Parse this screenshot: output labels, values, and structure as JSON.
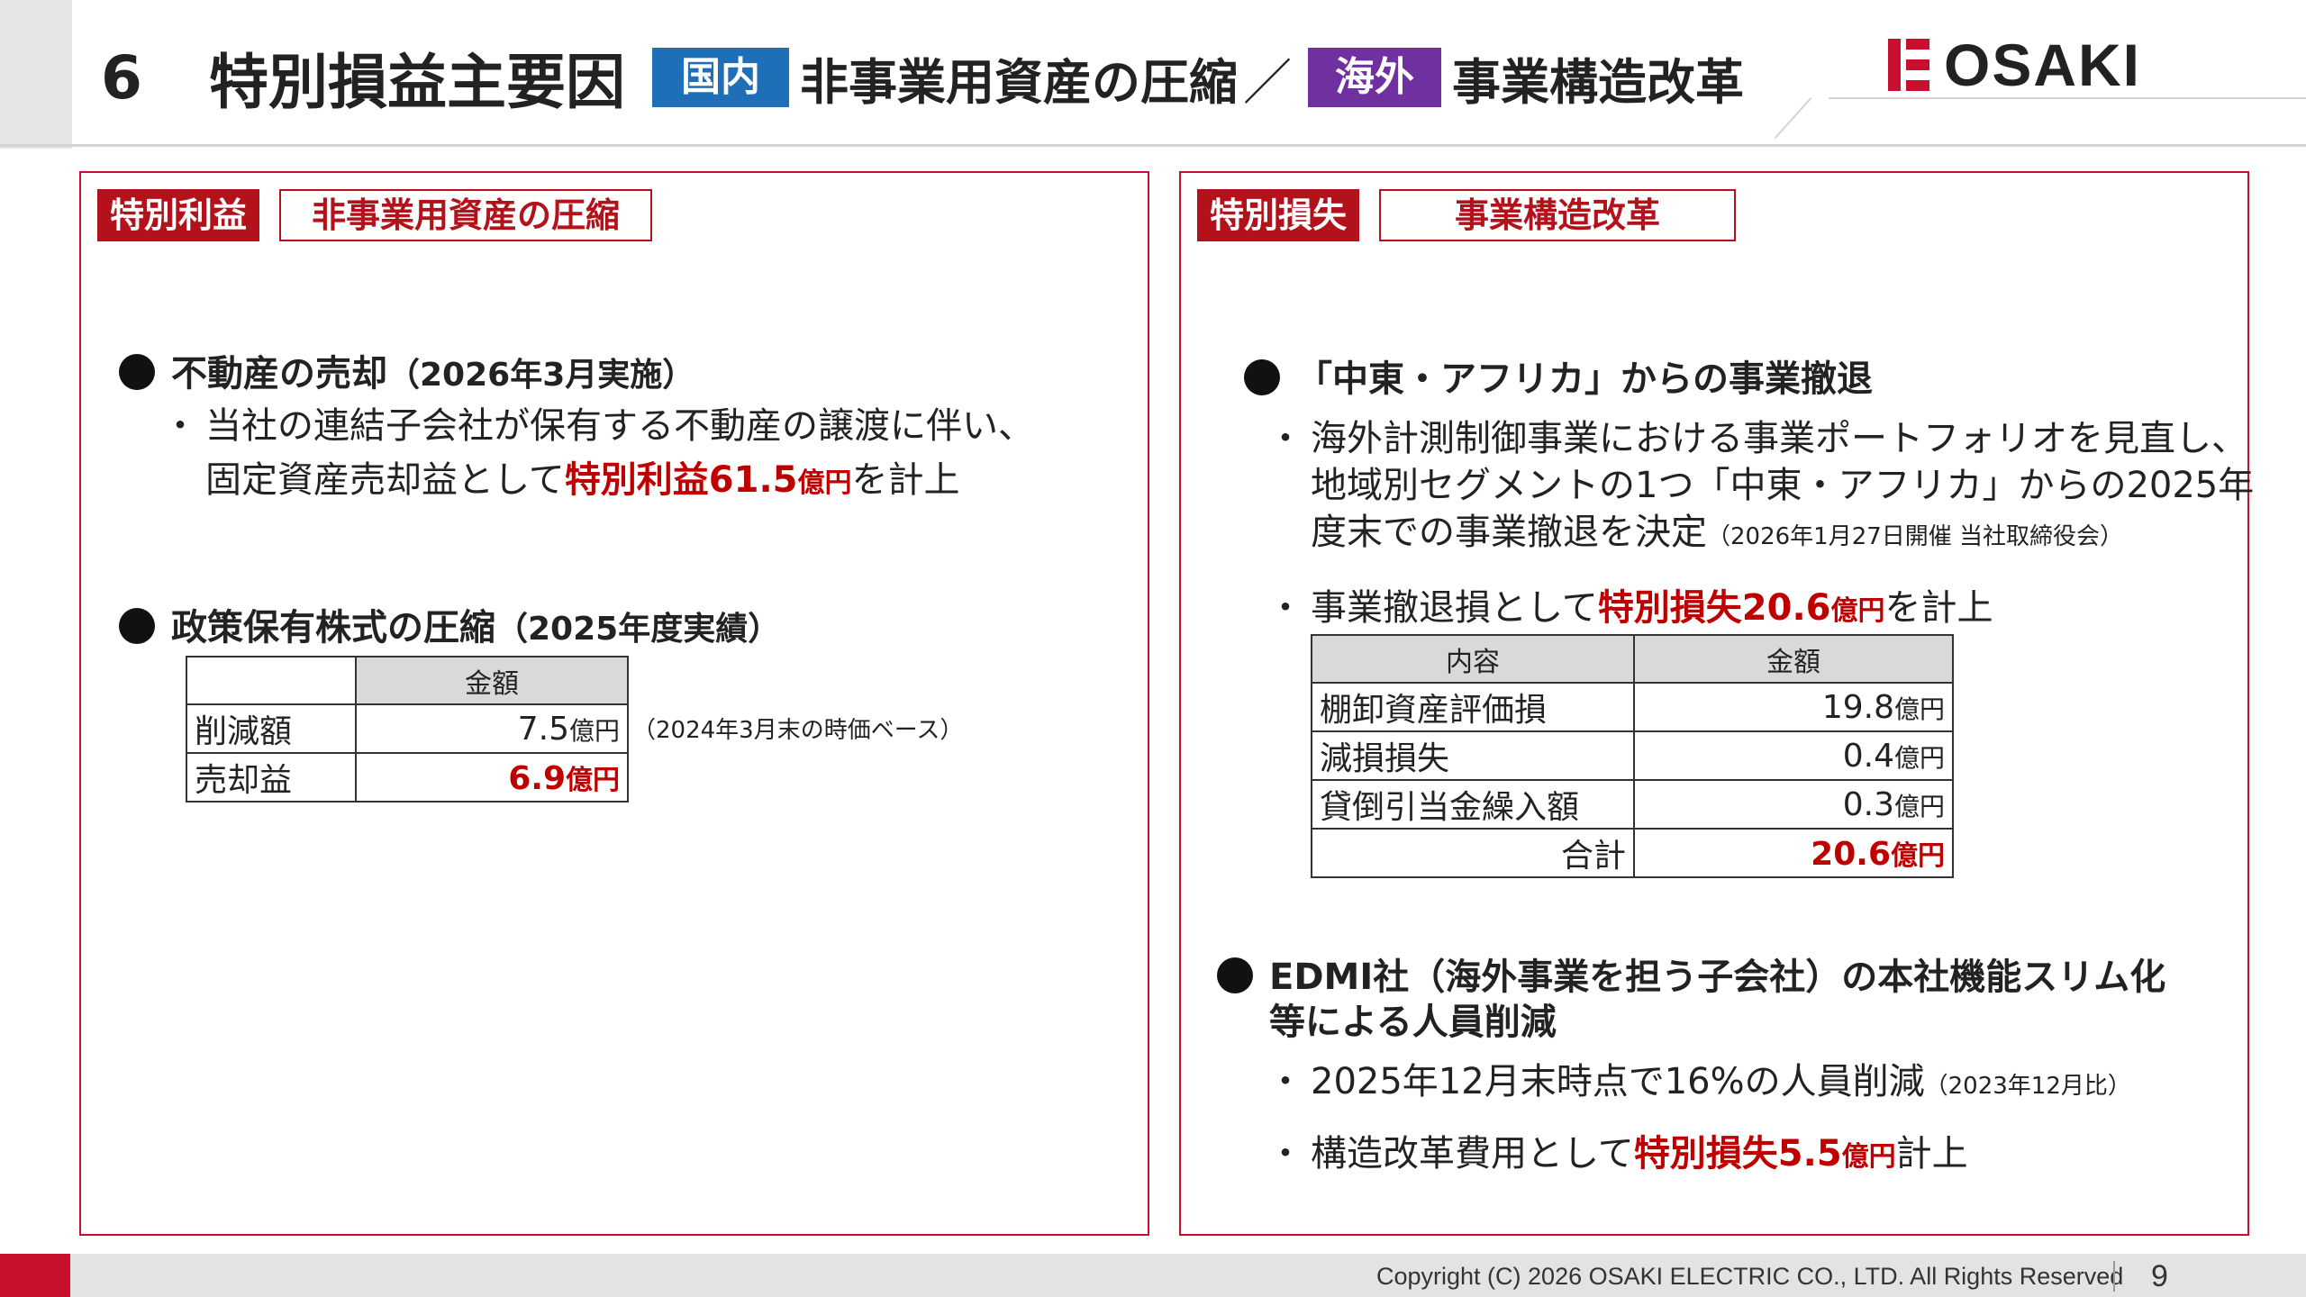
{
  "header": {
    "number": "6",
    "title": "特別損益主要因",
    "badge_domestic": "国内",
    "sub_domestic": "非事業用資産の圧縮",
    "slash": "／",
    "badge_overseas": "海外",
    "sub_overseas": "事業構造改革",
    "logo_text": "OSAKI"
  },
  "colors": {
    "brand_red": "#c8102e",
    "highlight_red": "#c00000",
    "badge_blue": "#1f6fb8",
    "badge_purple": "#7030a0"
  },
  "left_panel": {
    "tag": "特別利益",
    "tag_title": "非事業用資産の圧縮",
    "item1": {
      "heading": "不動産の売却",
      "heading_paren": "（2026年3月実施）",
      "line1": "当社の連結子会社が保有する不動産の譲渡に伴い、",
      "line2_pre": "固定資産売却益として",
      "line2_hl": "特別利益61.5",
      "line2_unit": "億円",
      "line2_post": "を計上"
    },
    "item2": {
      "heading": "政策保有株式の圧縮",
      "heading_paren": "（2025年度実績）",
      "table": {
        "header_blank": "",
        "header_amount": "金額",
        "rows": [
          {
            "label": "削減額",
            "value": "7.5",
            "unit": "億円",
            "note": "（2024年3月末の時価ベース）"
          },
          {
            "label": "売却益",
            "value": "6.9",
            "unit": "億円"
          }
        ]
      }
    }
  },
  "right_panel": {
    "tag": "特別損失",
    "tag_title": "事業構造改革",
    "item1": {
      "heading": "「中東・アフリカ」からの事業撤退",
      "line1": "海外計測制御事業における事業ポートフォリオを見直し、",
      "line2": "地域別セグメントの1つ「中東・アフリカ」からの2025年",
      "line3": "度末での事業撤退を決定",
      "line3_note": "（2026年1月27日開催 当社取締役会）",
      "line4_pre": "事業撤退損として",
      "line4_hl": "特別損失20.6",
      "line4_unit": "億円",
      "line4_post": "を計上",
      "table": {
        "header_content": "内容",
        "header_amount": "金額",
        "rows": [
          {
            "label": "棚卸資産評価損",
            "value": "19.8",
            "unit": "億円"
          },
          {
            "label": "減損損失",
            "value": "0.4",
            "unit": "億円"
          },
          {
            "label": "貸倒引当金繰入額",
            "value": "0.3",
            "unit": "億円"
          }
        ],
        "total_label": "合計",
        "total_value": "20.6",
        "total_unit": "億円"
      }
    },
    "item2": {
      "heading_line1": "EDMI社（海外事業を担う子会社）の本社機能スリム化",
      "heading_line2": "等による人員削減",
      "line1": "2025年12月末時点で16%の人員削減",
      "line1_note": "（2023年12月比）",
      "line2_pre": "構造改革費用として",
      "line2_hl": "特別損失5.5",
      "line2_unit": "億円",
      "line2_post": "計上"
    }
  },
  "footer": {
    "copyright": "Copyright (C) 2026 OSAKI ELECTRIC CO., LTD. All Rights Reserved",
    "page": "9"
  }
}
